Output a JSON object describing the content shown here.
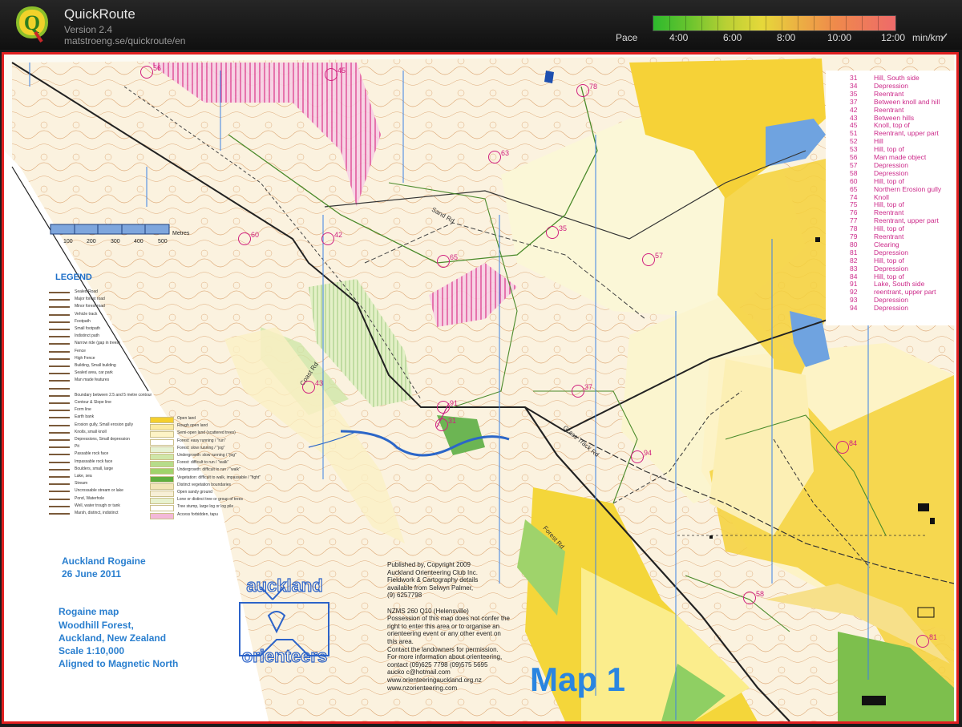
{
  "app": {
    "title": "QuickRoute",
    "version": "Version 2.4",
    "url": "matstroeng.se/quickroute/en",
    "logo_letter": "Q"
  },
  "pace": {
    "label": "Pace",
    "ticks": [
      "4:00",
      "6:00",
      "8:00",
      "10:00",
      "12:00"
    ],
    "unit": "min/km",
    "colors": [
      "#2db92d",
      "#b9d034",
      "#e6d83a",
      "#ef8a4b",
      "#ee6a6a"
    ]
  },
  "map": {
    "title": "Map 1",
    "event_name": "Auckland Rogaine",
    "event_date": "26 June 2011",
    "map_info": [
      "Rogaine map",
      "Woodhill Forest,",
      "Auckland, New Zealand",
      "Scale 1:10,000",
      "Aligned to Magnetic North"
    ],
    "club_logo_lines": [
      "auckland",
      "orienteers"
    ],
    "scale_bar": {
      "labels": [
        "100",
        "200",
        "300",
        "400",
        "500"
      ],
      "unit": "Metres"
    },
    "road_names": [
      "Coast Rd",
      "Sand Rd",
      "Grass Track Rd",
      "Forest Rd"
    ],
    "publisher_lines": [
      "Published by, Copyright 2009",
      "Auckland Orienteering Club Inc.",
      "Fieldwork & Cartography details",
      "available from Selwyn Palmer,",
      "(9) 6257798",
      "",
      "NZMS 260 Q10 (Helensville)",
      "Possession of this map does not confer the",
      "right to enter this area or to organise an",
      "orienteering event or any other event on",
      "this area.",
      "Contact the landowners for permission.",
      "For more information about orienteering,",
      "contact (09)625 7798  (09)575 5695",
      "aucko c@hotmail.com",
      "www.orienteeringauckland.org.nz",
      "www.nzorienteering.com"
    ],
    "controls": [
      {
        "num": "31",
        "desc": "Hill, South side"
      },
      {
        "num": "34",
        "desc": "Depression"
      },
      {
        "num": "35",
        "desc": "Reentrant"
      },
      {
        "num": "37",
        "desc": "Between knoll and hill"
      },
      {
        "num": "42",
        "desc": "Reentrant"
      },
      {
        "num": "43",
        "desc": "Between hills"
      },
      {
        "num": "45",
        "desc": "Knoll, top of"
      },
      {
        "num": "51",
        "desc": "Reentrant, upper part"
      },
      {
        "num": "52",
        "desc": "Hill"
      },
      {
        "num": "53",
        "desc": "Hill, top of"
      },
      {
        "num": "56",
        "desc": "Man made object"
      },
      {
        "num": "57",
        "desc": "Depression"
      },
      {
        "num": "58",
        "desc": "Depression"
      },
      {
        "num": "60",
        "desc": "Hill, top of"
      },
      {
        "num": "65",
        "desc": "Northern Erosion gully"
      },
      {
        "num": "74",
        "desc": "Knoll"
      },
      {
        "num": "75",
        "desc": "Hill, top of"
      },
      {
        "num": "76",
        "desc": "Reentrant"
      },
      {
        "num": "77",
        "desc": "Reentrant, upper part"
      },
      {
        "num": "78",
        "desc": "Hill, top of"
      },
      {
        "num": "79",
        "desc": "Reentrant"
      },
      {
        "num": "80",
        "desc": "Clearing"
      },
      {
        "num": "81",
        "desc": "Depression"
      },
      {
        "num": "82",
        "desc": "Hill, top of"
      },
      {
        "num": "83",
        "desc": "Depression"
      },
      {
        "num": "84",
        "desc": "Hill, top of"
      },
      {
        "num": "91",
        "desc": "Lake, South side"
      },
      {
        "num": "92",
        "desc": "reentrant, upper part"
      },
      {
        "num": "93",
        "desc": "Depression"
      },
      {
        "num": "94",
        "desc": "Depression"
      }
    ],
    "control_markers": [
      "56",
      "45",
      "78",
      "63",
      "60",
      "42",
      "65",
      "35",
      "37",
      "91",
      "43",
      "84",
      "58",
      "81",
      "57",
      "94",
      "31"
    ],
    "legend": {
      "title": "LEGEND",
      "left_items": [
        "Sealed Road",
        "Major forest road",
        "Minor forest road",
        "Vehicle track",
        "Footpath",
        "Small footpath",
        "Indistinct path",
        "Narrow ride (gap in trees)",
        "Fence",
        "High Fence",
        "Building, Small building",
        "Sealed area, car park",
        "Man made features",
        "",
        "Boundary between 2.5 and 5 metre contour",
        "Contour & Slope line",
        "Form line",
        "Earth bank",
        "Erosion gully, Small erosion gully",
        "Knolls, small knoll",
        "Depressions, Small depression",
        "Pit",
        "Passable rock face",
        "Impassable rock face",
        "Boulders, small, large",
        "Lake, sea",
        "Stream",
        "Uncrossable stream or lake",
        "Pond, Waterhole",
        "Well, water trough or tank",
        "Marsh, distinct, indistinct"
      ],
      "right_items": [
        "Open land",
        "Rough open land",
        "Semi-open land (scattered trees)",
        "Forest: easy running / \"run\"",
        "Forest: slow running / \"jog\"",
        "Undergrowth: slow running / \"jog\"",
        "Forest: difficult to run / \"walk\"",
        "Undergrowth: difficult to run / \"walk\"",
        "Vegetation: difficult to walk, impassable / \"fight\"",
        "Distinct vegetation boundaries",
        "Open sandy ground",
        "Lone or distinct tree or group of trees",
        "Tree stump, large log or log pile",
        "Access forbidden, tapu"
      ]
    }
  }
}
